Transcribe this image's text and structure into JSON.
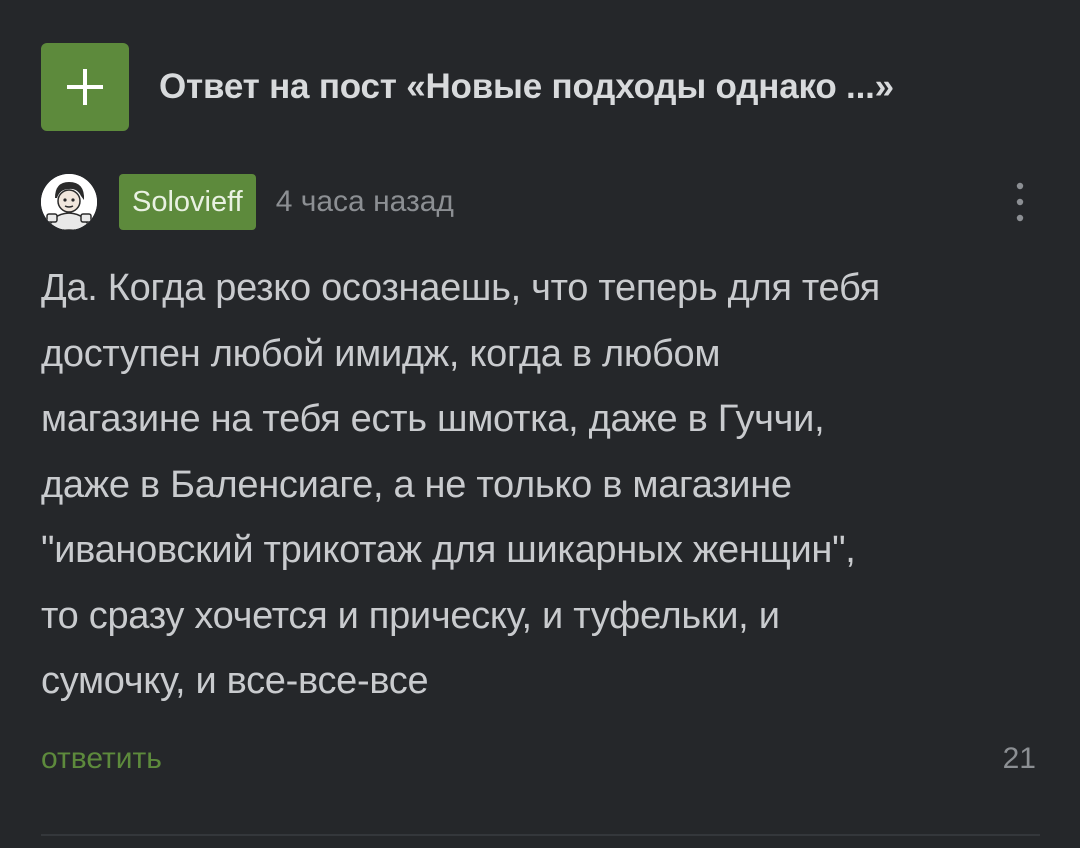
{
  "header": {
    "plus_icon": "plus-icon",
    "title": "Ответ на пост «Новые подходы однако ...»"
  },
  "comment": {
    "author": "Solovieff",
    "time": "4 часа назад",
    "more_icon": "more-vertical-icon",
    "lines": [
      "Да. Когда резко осознаешь, что теперь для тебя",
      "доступен любой имидж, когда в любом",
      "магазине на тебя есть шмотка, даже в Гуччи,",
      "даже в Баленсиаге, а не только в магазине",
      "\"ивановский трикотаж для шикарных женщин\",",
      "то сразу хочется и прическу, и туфельки, и",
      "сумочку, и все-все-все"
    ],
    "reply_label": "ответить",
    "rating": "21"
  },
  "colors": {
    "background": "#25272a",
    "accent_green": "#5d8a3c",
    "text": "#c9cbce",
    "muted": "#8c8f93"
  }
}
